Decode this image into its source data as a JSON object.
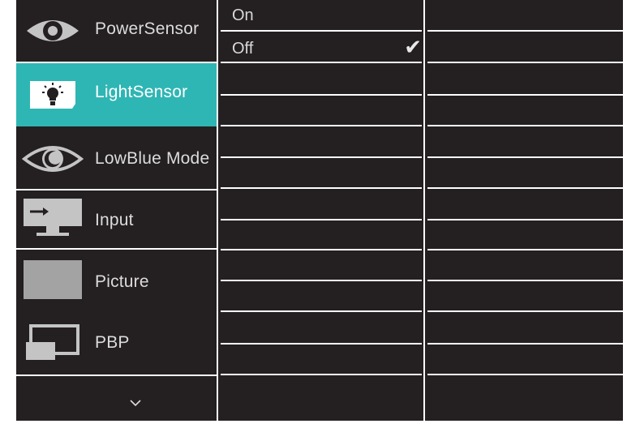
{
  "menu": {
    "items": [
      {
        "label": "PowerSensor",
        "icon": "eye-icon"
      },
      {
        "label": "LightSensor",
        "icon": "light-bulb-icon"
      },
      {
        "label": "LowBlue Mode",
        "icon": "lowblue-eye-icon"
      },
      {
        "label": "Input",
        "icon": "input-monitor-icon"
      },
      {
        "label": "Picture",
        "icon": "picture-icon"
      },
      {
        "label": "PBP",
        "icon": "pbp-icon"
      }
    ],
    "active_index": 1,
    "more_icon": "chevron-down-icon"
  },
  "submenu": {
    "options": [
      {
        "label": "On",
        "selected": false
      },
      {
        "label": "Off",
        "selected": true
      }
    ],
    "check_glyph": "✔"
  },
  "colors": {
    "background": "#241f20",
    "accent": "#2eb6b4",
    "divider": "#ffffff",
    "text": "#dcdcdc"
  }
}
